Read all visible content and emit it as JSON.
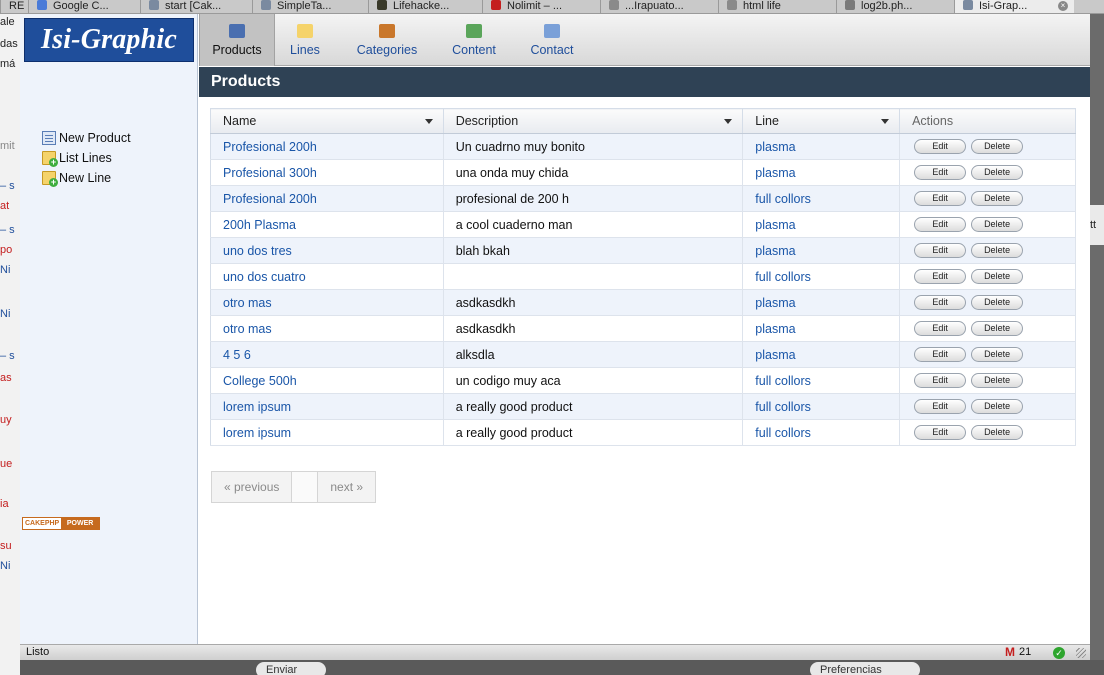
{
  "browser": {
    "tabs": [
      {
        "label": "RE",
        "icon": "blank-page-icon"
      },
      {
        "label": "Google C...",
        "icon": "google-icon"
      },
      {
        "label": "start [Cak...",
        "icon": "page-icon"
      },
      {
        "label": "SimpleTa...",
        "icon": "page-icon"
      },
      {
        "label": "Lifehacke...",
        "icon": "lifehacker-icon"
      },
      {
        "label": "Nolimit – ...",
        "icon": "page-icon"
      },
      {
        "label": "...Irapuato...",
        "icon": "page-icon"
      },
      {
        "label": "html life",
        "icon": "page-icon"
      },
      {
        "label": "log2b.ph...",
        "icon": "page-icon"
      },
      {
        "label": "Isi-Grap...",
        "icon": "page-icon"
      }
    ],
    "status_text": "Listo",
    "mail_count": "21"
  },
  "app": {
    "logo": "Isi-Graphic",
    "nav": [
      {
        "label": "Products",
        "icon": "products-icon",
        "active": true
      },
      {
        "label": "Lines",
        "icon": "folder-icon",
        "active": false
      },
      {
        "label": "Categories",
        "icon": "categories-icon",
        "active": false
      },
      {
        "label": "Content",
        "icon": "content-icon",
        "active": false
      },
      {
        "label": "Contact",
        "icon": "contact-icon",
        "active": false
      }
    ],
    "sidebar": {
      "items": [
        {
          "label": "New Product",
          "icon": "new-product-icon"
        },
        {
          "label": "List Lines",
          "icon": "list-lines-icon"
        },
        {
          "label": "New Line",
          "icon": "new-line-icon"
        }
      ],
      "badge_left": "CAKEPHP",
      "badge_right": "POWER"
    },
    "page_title": "Products",
    "table": {
      "columns": [
        "Name",
        "Description",
        "Line",
        "Actions"
      ],
      "rows": [
        {
          "name": "Profesional 200h",
          "description": "Un cuadrno muy bonito",
          "line": "plasma"
        },
        {
          "name": "Profesional 300h",
          "description": "una onda muy chida",
          "line": "plasma"
        },
        {
          "name": "Profesional 200h",
          "description": "profesional de 200 h",
          "line": "full collors"
        },
        {
          "name": "200h Plasma",
          "description": "a cool cuaderno man",
          "line": "plasma"
        },
        {
          "name": "uno dos tres",
          "description": "blah bkah",
          "line": "plasma"
        },
        {
          "name": "uno dos cuatro",
          "description": "",
          "line": "full collors"
        },
        {
          "name": "otro mas",
          "description": "asdkasdkh",
          "line": "plasma"
        },
        {
          "name": "otro mas",
          "description": "asdkasdkh",
          "line": "plasma"
        },
        {
          "name": "4 5 6",
          "description": "alksdla",
          "line": "plasma"
        },
        {
          "name": "College 500h",
          "description": "un codigo muy aca",
          "line": "full collors"
        },
        {
          "name": "lorem ipsum",
          "description": "a really good product",
          "line": "full collors"
        },
        {
          "name": "lorem ipsum",
          "description": "a really good product",
          "line": "full collors"
        }
      ],
      "edit_label": "Edit",
      "delete_label": "Delete"
    },
    "pager": {
      "previous": "« previous",
      "next": "next »"
    }
  },
  "colors": {
    "brand": "#1f4e9b",
    "title_bar": "#2f4255",
    "link": "#1a56a8",
    "row_alt": "#eef3fb"
  }
}
